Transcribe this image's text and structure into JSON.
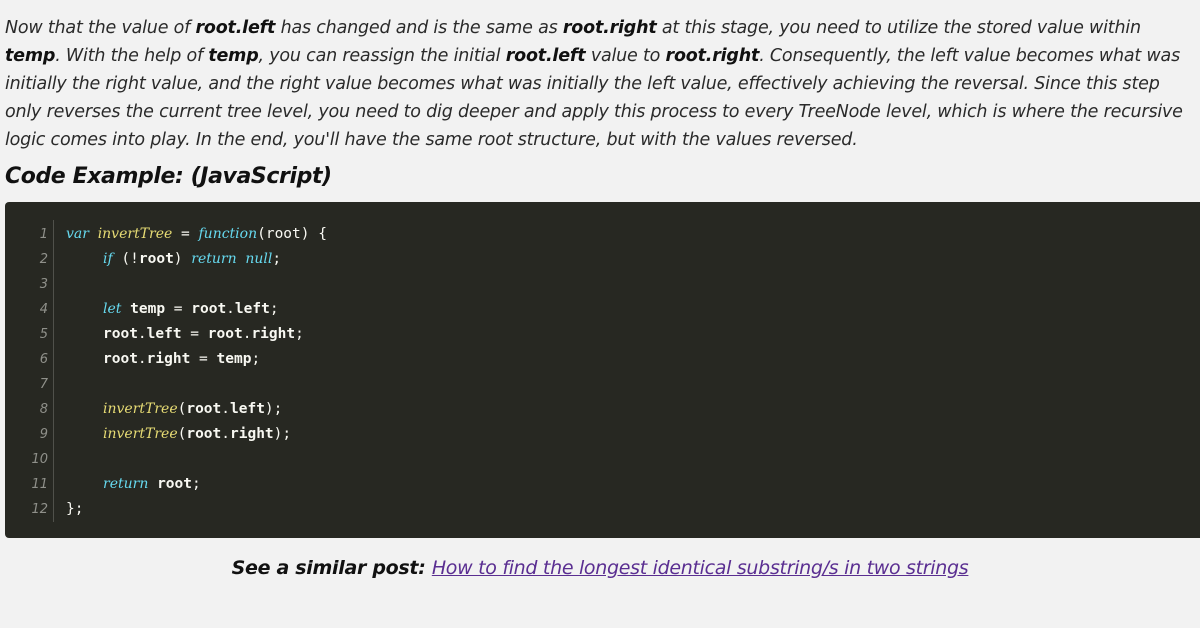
{
  "paragraph": {
    "t1": "Now that the value of ",
    "b1": "root.left",
    "t2": " has changed and is the same as ",
    "b2": "root.right",
    "t3": " at this stage, you need to utilize the stored value within ",
    "b3": "temp",
    "t4": ". With the help of ",
    "b4": "temp",
    "t5": ", you can reassign the initial ",
    "b5": "root.left",
    "t6": " value to ",
    "b6": "root.right",
    "t7": ". Consequently, the left value becomes what was initially the right value, and the right value becomes what was initially the left value, effectively achieving the reversal. Since this step only reverses the current tree level, you need to dig deeper and apply this process to every TreeNode level, which is where the recursive logic comes into play. In the end, you'll have the same root structure, but with the values reversed."
  },
  "heading": "Code Example: (JavaScript)",
  "code": {
    "line_numbers": [
      "1",
      "2",
      "3",
      "4",
      "5",
      "6",
      "7",
      "8",
      "9",
      "10",
      "11",
      "12"
    ],
    "l1": {
      "kw": "var",
      "fn": "invertTree",
      "op": " = ",
      "fk": "function",
      "rest": "(root) {"
    },
    "l2": {
      "kw": "if",
      "rest1": " (!",
      "id": "root",
      "rest2": ") ",
      "kw2": "return",
      "kw3": "null",
      "end": ";"
    },
    "l4": {
      "kw": "let",
      "id1": "temp",
      "op": " = ",
      "id2": "root",
      "dot": ".",
      "id3": "left",
      "end": ";"
    },
    "l5": {
      "id1": "root",
      "dot1": ".",
      "id2": "left",
      "op": " = ",
      "id3": "root",
      "dot2": ".",
      "id4": "right",
      "end": ";"
    },
    "l6": {
      "id1": "root",
      "dot1": ".",
      "id2": "right",
      "op": " = ",
      "id3": "temp",
      "end": ";"
    },
    "l8": {
      "fn": "invertTree",
      "p1": "(",
      "id1": "root",
      "dot": ".",
      "id2": "left",
      "p2": ");"
    },
    "l9": {
      "fn": "invertTree",
      "p1": "(",
      "id1": "root",
      "dot": ".",
      "id2": "right",
      "p2": ");"
    },
    "l11": {
      "kw": "return",
      "id": "root",
      "end": ";"
    },
    "l12": {
      "text": "};"
    }
  },
  "similar": {
    "label": "See a similar post: ",
    "link": "How to find the longest identical substring/s in two strings"
  },
  "colors": {
    "code_bg": "#272822",
    "keyword": "#66d9ef",
    "function_name": "#e6db74",
    "link": "#5a2e91"
  }
}
